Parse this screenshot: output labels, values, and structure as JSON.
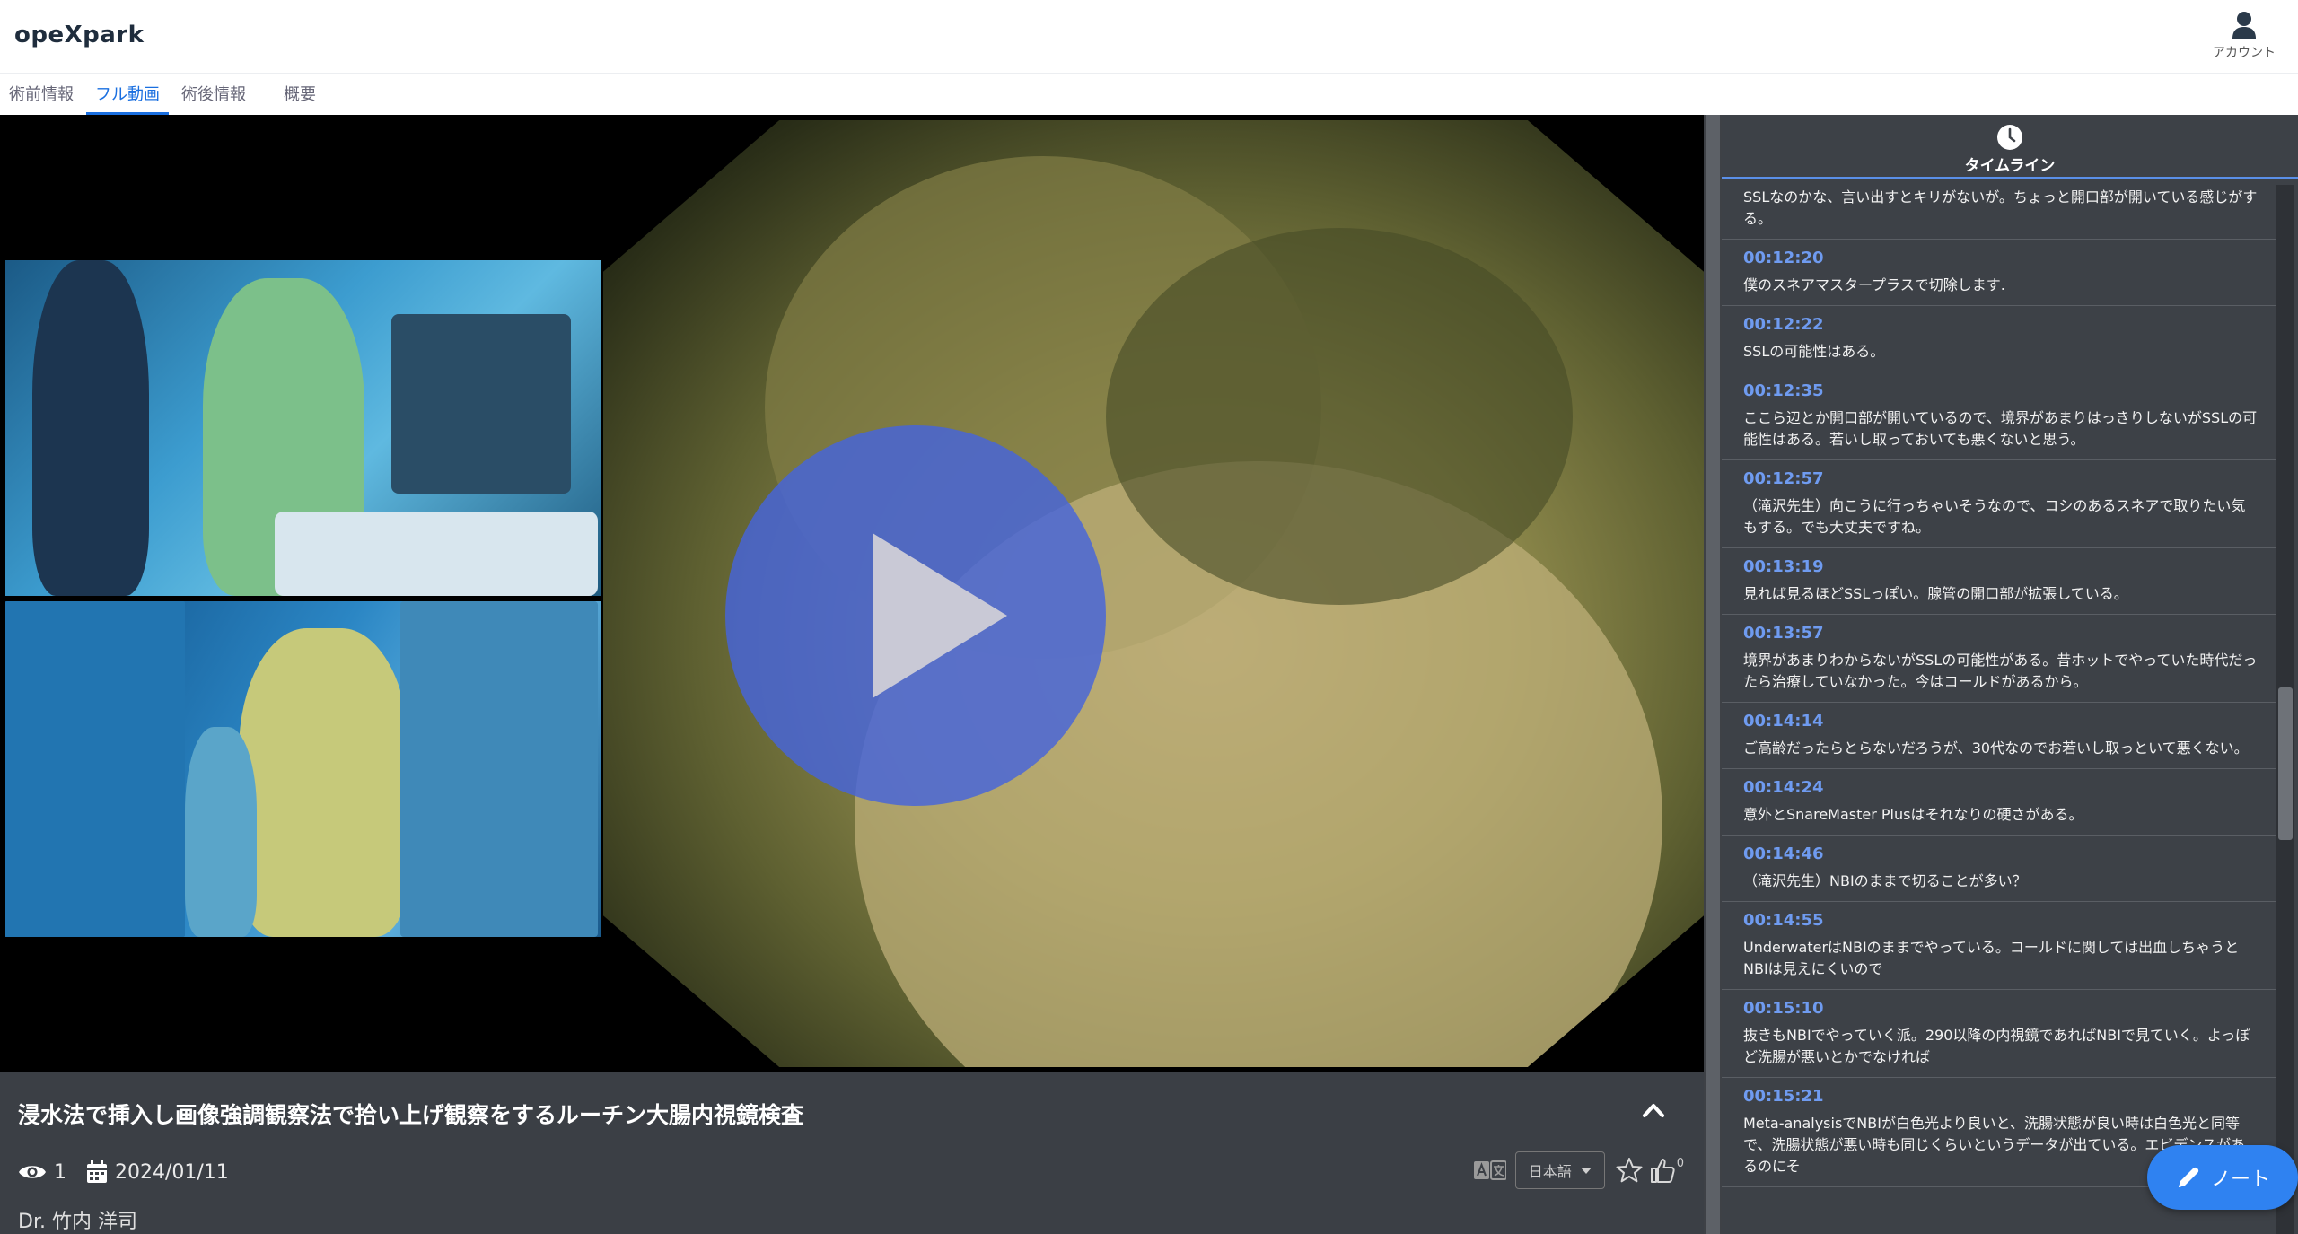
{
  "app": {
    "logo": "opeXpark",
    "account_label": "アカウント"
  },
  "tabs": [
    {
      "label": "術前情報"
    },
    {
      "label": "フル動画",
      "active": true
    },
    {
      "label": "術後情報"
    },
    {
      "label": "概要"
    }
  ],
  "video": {
    "title": "浸水法で挿入し画像強調観察法で拾い上げ観察をするルーチン大腸内視鏡検査",
    "views": "1",
    "date": "2024/01/11",
    "doctor": "Dr. 竹内 洋司",
    "language": "日本語",
    "likes": "0"
  },
  "timeline": {
    "header": "タイムライン",
    "items": [
      {
        "time": "",
        "text": "SSLなのかな、言い出すとキリがないが。ちょっと開口部が開いている感じがする。"
      },
      {
        "time": "00:12:20",
        "text": "僕のスネアマスタープラスで切除します."
      },
      {
        "time": "00:12:22",
        "text": "SSLの可能性はある。"
      },
      {
        "time": "00:12:35",
        "text": "ここら辺とか開口部が開いているので、境界があまりはっきりしないがSSLの可能性はある。若いし取っておいても悪くないと思う。"
      },
      {
        "time": "00:12:57",
        "text": "（滝沢先生）向こうに行っちゃいそうなので、コシのあるスネアで取りたい気もする。でも大丈夫ですね。"
      },
      {
        "time": "00:13:19",
        "text": "見れば見るほどSSLっぽい。腺管の開口部が拡張している。"
      },
      {
        "time": "00:13:57",
        "text": "境界があまりわからないがSSLの可能性がある。昔ホットでやっていた時代だったら治療していなかった。今はコールドがあるから。"
      },
      {
        "time": "00:14:14",
        "text": "ご高齢だったらとらないだろうが、30代なのでお若いし取っといて悪くない。"
      },
      {
        "time": "00:14:24",
        "text": "意外とSnareMaster Plusはそれなりの硬さがある。"
      },
      {
        "time": "00:14:46",
        "text": "（滝沢先生）NBIのままで切ることが多い？"
      },
      {
        "time": "00:14:55",
        "text": "UnderwaterはNBIのままでやっている。コールドに関しては出血しちゃうとNBIは見えにくいので"
      },
      {
        "time": "00:15:10",
        "text": "抜きもNBIでやっていく派。290以降の内視鏡であればNBIで見ていく。よっぽど洗腸が悪いとかでなければ"
      },
      {
        "time": "00:15:21",
        "text": "Meta-analysisでNBIが白色光より良いと、洗腸状態が良い時は白色光と同等で、洗腸状態が悪い時も同じくらいというデータが出ている。エビデンスがあるのにそ"
      }
    ]
  },
  "note_button": {
    "label": "ノート"
  },
  "colors": {
    "accent": "#1a6fe0",
    "timestamp": "#6f9bf0",
    "note_button": "#2f82f1",
    "panel_bg": "#3d4147"
  },
  "icons": [
    "account-icon",
    "clock-icon",
    "eye-icon",
    "calendar-icon",
    "translate-icon",
    "star-icon",
    "thumbs-up-icon",
    "chevron-up-icon",
    "play-icon",
    "pencil-icon"
  ]
}
